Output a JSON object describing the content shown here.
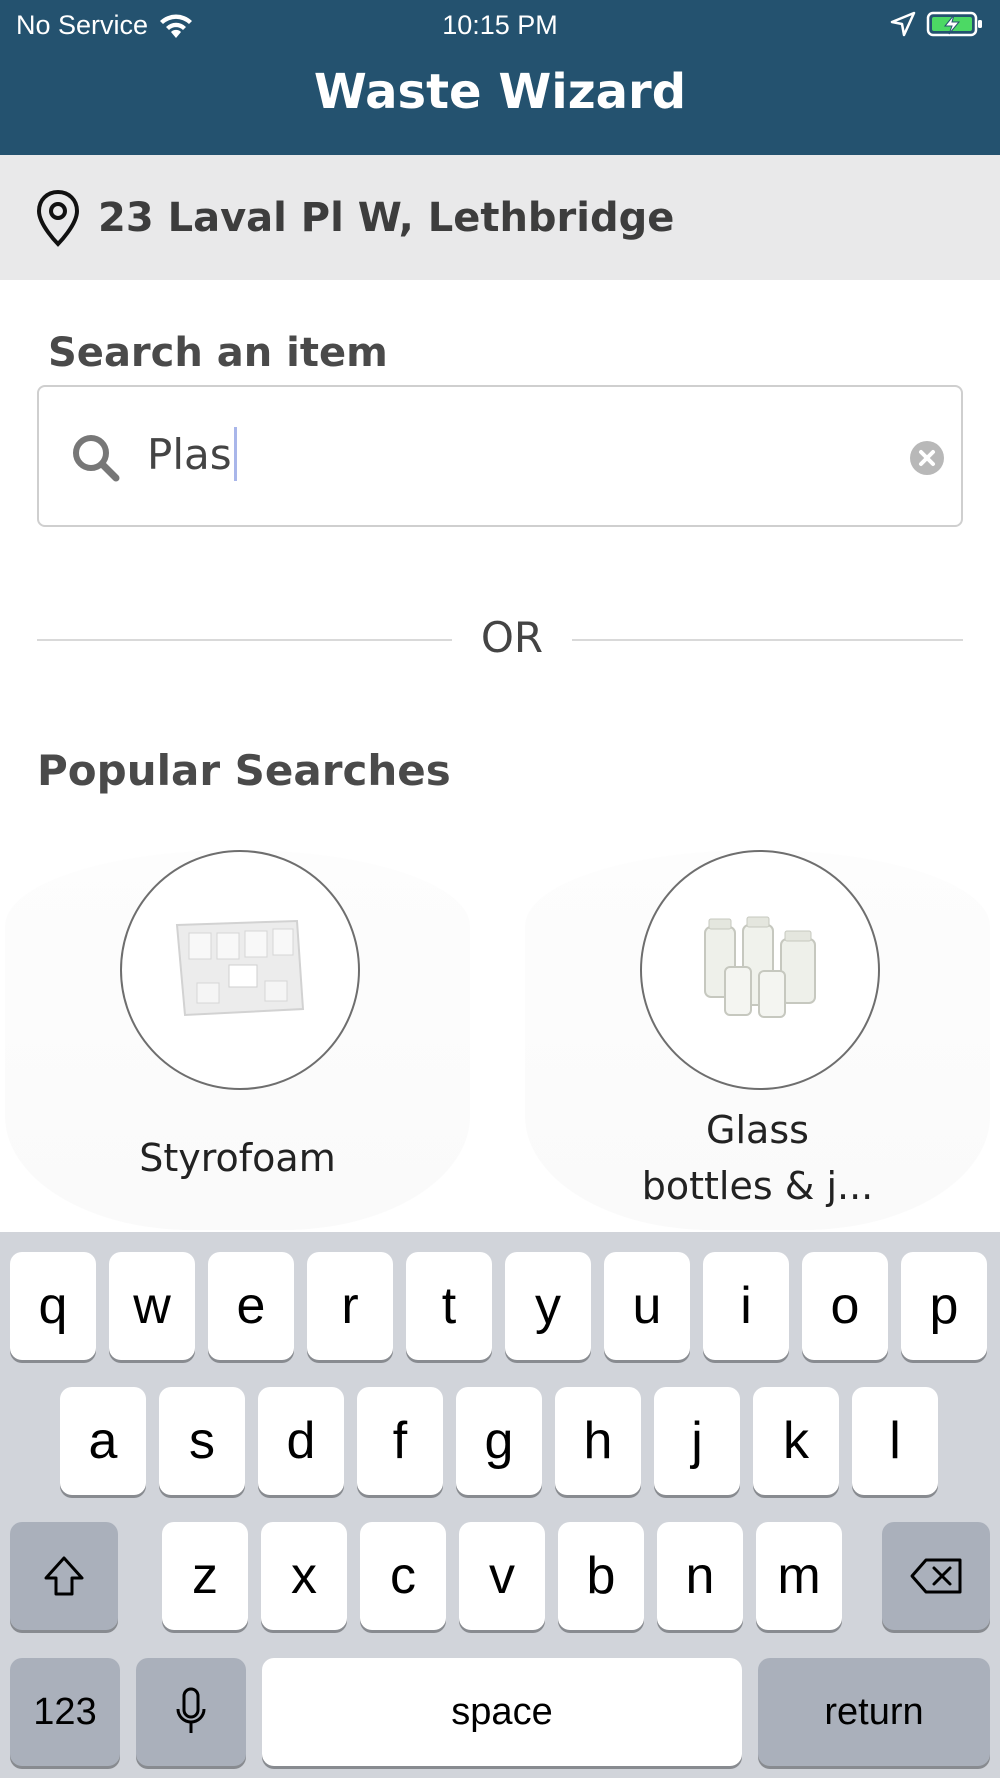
{
  "status_bar": {
    "carrier": "No Service",
    "time": "10:15 PM"
  },
  "header": {
    "title": "Waste Wizard"
  },
  "location": {
    "address": "23 Laval Pl W, Lethbridge"
  },
  "search": {
    "label": "Search an item",
    "value": "Plas"
  },
  "divider": {
    "text": "OR"
  },
  "popular": {
    "title": "Popular Searches",
    "items": [
      {
        "label": "Styrofoam"
      },
      {
        "label_line1": "Glass",
        "label_line2": "bottles & j..."
      }
    ]
  },
  "keyboard": {
    "row1": [
      "q",
      "w",
      "e",
      "r",
      "t",
      "y",
      "u",
      "i",
      "o",
      "p"
    ],
    "row2": [
      "a",
      "s",
      "d",
      "f",
      "g",
      "h",
      "j",
      "k",
      "l"
    ],
    "row3": [
      "z",
      "x",
      "c",
      "v",
      "b",
      "n",
      "m"
    ],
    "numbers_key": "123",
    "space_key": "space",
    "return_key": "return"
  },
  "colors": {
    "header_bg": "#24526f",
    "location_bg": "#e9e9ea",
    "battery_green": "#4cd964"
  }
}
